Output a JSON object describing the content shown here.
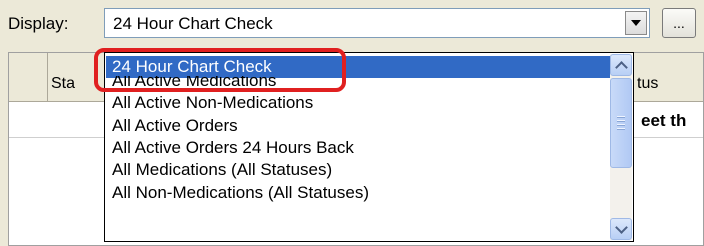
{
  "display": {
    "label": "Display:",
    "value": "24 Hour Chart Check",
    "ellipsis_label": "..."
  },
  "grid": {
    "header_status_left": "Sta",
    "header_status_right": "tus",
    "row_text": "eet th"
  },
  "dropdown": {
    "options": [
      "24 Hour Chart Check",
      "All Active Medications",
      "All Active Non-Medications",
      "All Active Orders",
      "All Active Orders 24 Hours Back",
      "All Medications (All Statuses)",
      "All Non-Medications (All Statuses)"
    ],
    "selected_index": 0
  },
  "colors": {
    "selection": "#316ac5",
    "highlight_ring": "#e02020"
  }
}
